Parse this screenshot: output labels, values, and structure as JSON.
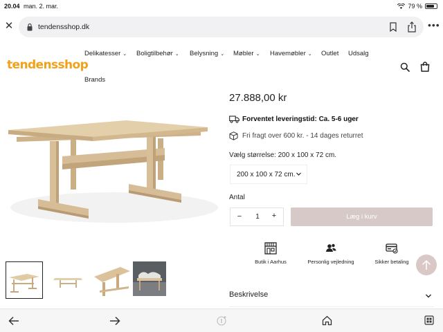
{
  "status_bar": {
    "time": "20.04",
    "date": "man. 2. mar.",
    "battery": "79 %",
    "battery_fraction": 0.79
  },
  "browser": {
    "url": "tendensshop.dk",
    "icons": [
      "close-icon",
      "lock-icon",
      "bookmark-icon",
      "share-icon",
      "more-icon"
    ]
  },
  "site": {
    "logo": "tendensshop",
    "brand_color": "#f0a21a",
    "nav": [
      {
        "label": "Delikatesser",
        "chevron": true
      },
      {
        "label": "Boligtilbehør",
        "chevron": true
      },
      {
        "label": "Belysning",
        "chevron": true
      },
      {
        "label": "Møbler",
        "chevron": true
      },
      {
        "label": "Havemøbler",
        "chevron": true
      },
      {
        "label": "Outlet",
        "chevron": false
      },
      {
        "label": "Udsalg",
        "chevron": false
      },
      {
        "label": "Brands",
        "chevron": false
      }
    ]
  },
  "product": {
    "price": "27.888,00 kr",
    "delivery_label": "Forventet leveringstid: Ca. 5-6 uger",
    "delivery_dash": "-",
    "freight_text": "Fri fragt over 600 kr. - 14 dages returret",
    "size_label": "Vælg størrelse: 200 x 100 x 72 cm.",
    "size_selected": "200 x 100 x 72 cm.",
    "quantity_label": "Antal",
    "quantity_minus": "−",
    "quantity_value": "1",
    "quantity_plus": "+",
    "add_to_cart": "Læg i kurv",
    "accent_color": "#d6c9c7"
  },
  "features": [
    {
      "label": "Butik i Aarhus",
      "icon": "store-icon"
    },
    {
      "label": "Personlig vejledning",
      "icon": "people-icon"
    },
    {
      "label": "Sikker betaling",
      "icon": "card-icon"
    }
  ],
  "description": {
    "title": "Beskrivelse"
  }
}
